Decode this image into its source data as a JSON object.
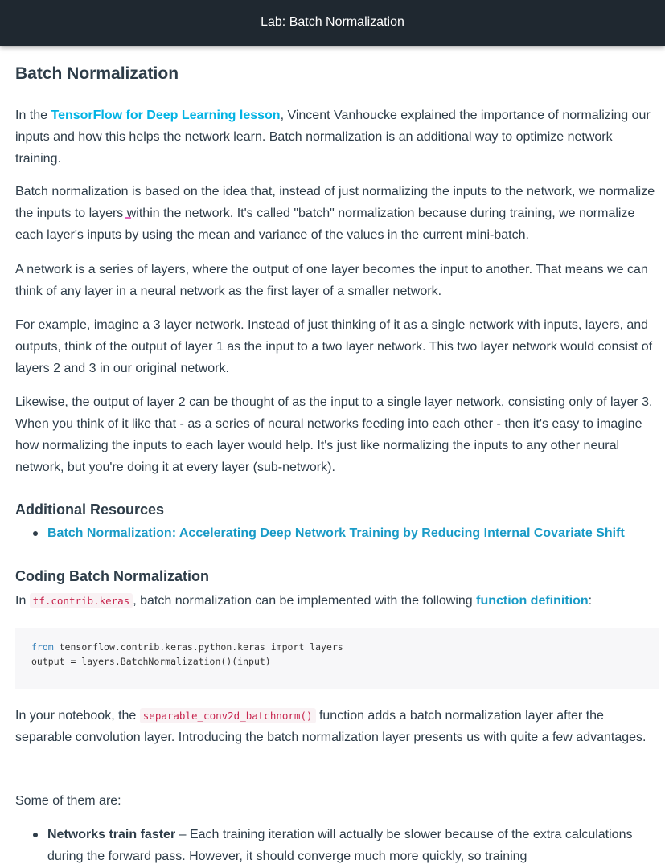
{
  "topbar": {
    "title": "Lab: Batch Normalization"
  },
  "page": {
    "title": "Batch Normalization",
    "p1": {
      "before": "In the ",
      "link": "TensorFlow for Deep Learning lesson",
      "after": ", Vincent Vanhoucke explained the importance of normalizing our inputs and how this helps the network learn. Batch normalization is an additional way to optimize network training."
    },
    "p2": "Batch normalization is based on the idea that, instead of just normalizing the inputs to the network, we normalize the inputs to layers within the network. It's called \"batch\" normalization because during training, we normalize each layer's inputs by using the mean and variance of the values in the current mini-batch.",
    "p3": "A network is a series of layers, where the output of one layer becomes the input to another. That means we can think of any layer in a neural network as the first layer of a smaller network.",
    "p4": "For example, imagine a 3 layer network. Instead of just thinking of it as a single network with inputs, layers, and outputs, think of the output of layer 1 as the input to a two layer network. This two layer network would consist of layers 2 and 3 in our original network.",
    "p5": "Likewise, the output of layer 2 can be thought of as the input to a single layer network, consisting only of layer 3. When you think of it like that - as a series of neural networks feeding into each other - then it's easy to imagine how normalizing the inputs to each layer would help. It's just like normalizing the inputs to any other neural network, but you're doing it at every layer (sub-network).",
    "resources": {
      "heading": "Additional Resources",
      "items": [
        "Batch Normalization: Accelerating Deep Network Training by Reducing Internal Covariate Shift"
      ]
    },
    "coding": {
      "heading": "Coding Batch Normalization",
      "intro_before": "In ",
      "intro_code": "tf.contrib.keras",
      "intro_mid": ", batch normalization can be implemented with the following ",
      "intro_link": "function definition",
      "intro_after": ":",
      "code_line1_kw": "from",
      "code_line1_rest": " tensorflow.contrib.keras.python.keras import layers",
      "code_line2": "output = layers.BatchNormalization()(input)"
    },
    "p6": {
      "before": "In your notebook, the ",
      "code": "separable_conv2d_batchnorm()",
      "after": " function adds a batch normalization layer after the separable convolution layer. Introducing the batch normalization layer presents us with quite a few advantages."
    },
    "p7": "Some of them are:",
    "advantages": [
      {
        "bold": "Networks train faster",
        "text": " – Each training iteration will actually be slower because of the extra calculations during the forward pass. However, it should converge much more quickly, so training"
      }
    ]
  }
}
